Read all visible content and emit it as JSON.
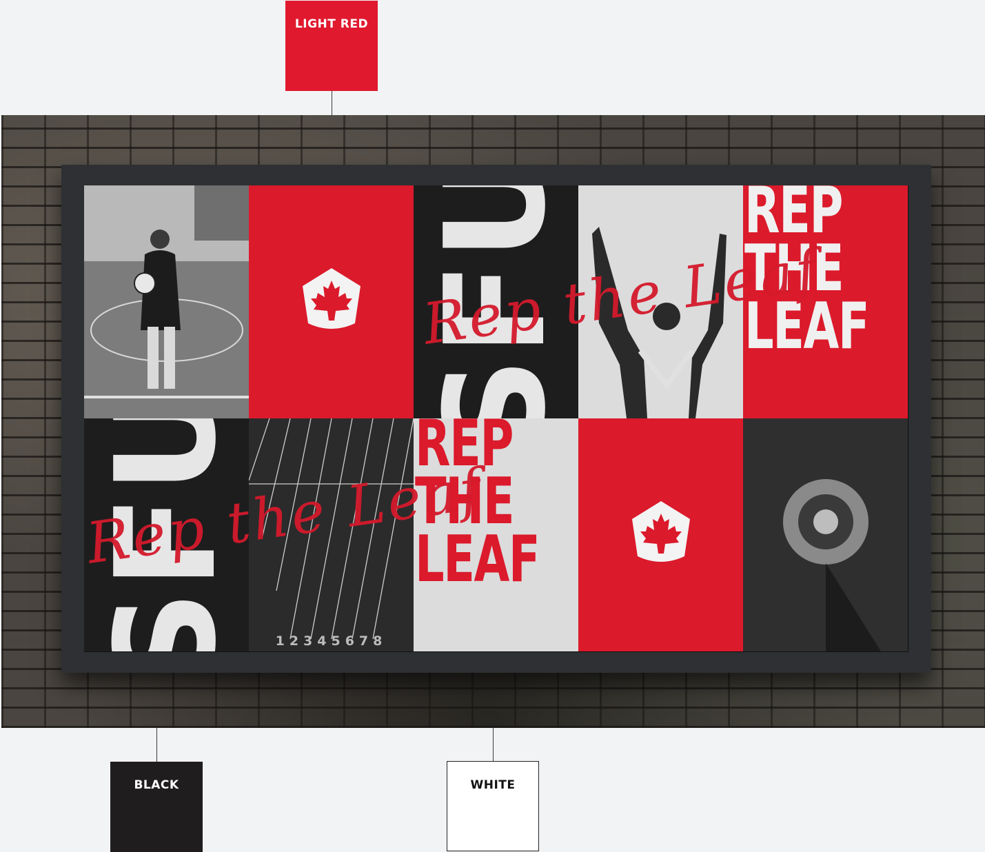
{
  "swatches": {
    "light_red": {
      "label": "LIGHT RED",
      "color": "#e0192f"
    },
    "black": {
      "label": "BLACK",
      "color": "#201d1e"
    },
    "white": {
      "label": "WHITE",
      "color": "#ffffff"
    }
  },
  "billboard": {
    "wordmark": "SFU",
    "headline": "REP\nTHE\nLEAF",
    "script_tagline": "Rep the Leaf",
    "lane_numbers": "12345678",
    "icons": [
      "maple-leaf-badge-icon"
    ]
  }
}
